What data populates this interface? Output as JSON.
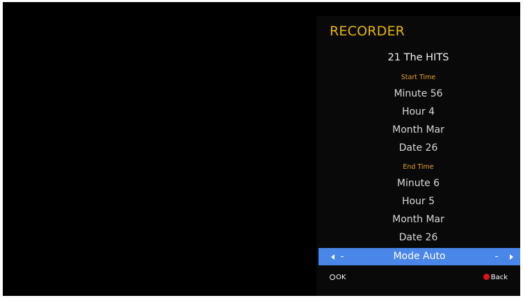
{
  "recorder": {
    "title": "RECORDER",
    "channel": "21 The HITS",
    "start_time": {
      "header": "Start Time",
      "minute": "Minute 56",
      "hour": "Hour 4",
      "month": "Month Mar",
      "date": "Date 26"
    },
    "end_time": {
      "header": "End Time",
      "minute": "Minute 6",
      "hour": "Hour 5",
      "month": "Month Mar",
      "date": "Date 26"
    },
    "mode": {
      "label": "Mode Auto",
      "left_icon": "left-arrow-icon",
      "right_icon": "right-arrow-icon"
    },
    "footer": {
      "ok_label": "OK",
      "ok_icon": "ok-circle-icon",
      "back_label": "Back",
      "back_icon": "red-dot-icon"
    }
  },
  "colors": {
    "title": "#e8b800",
    "section_header": "#e3a12c",
    "highlight": "#4a86e8",
    "back_button": "#e01414"
  }
}
